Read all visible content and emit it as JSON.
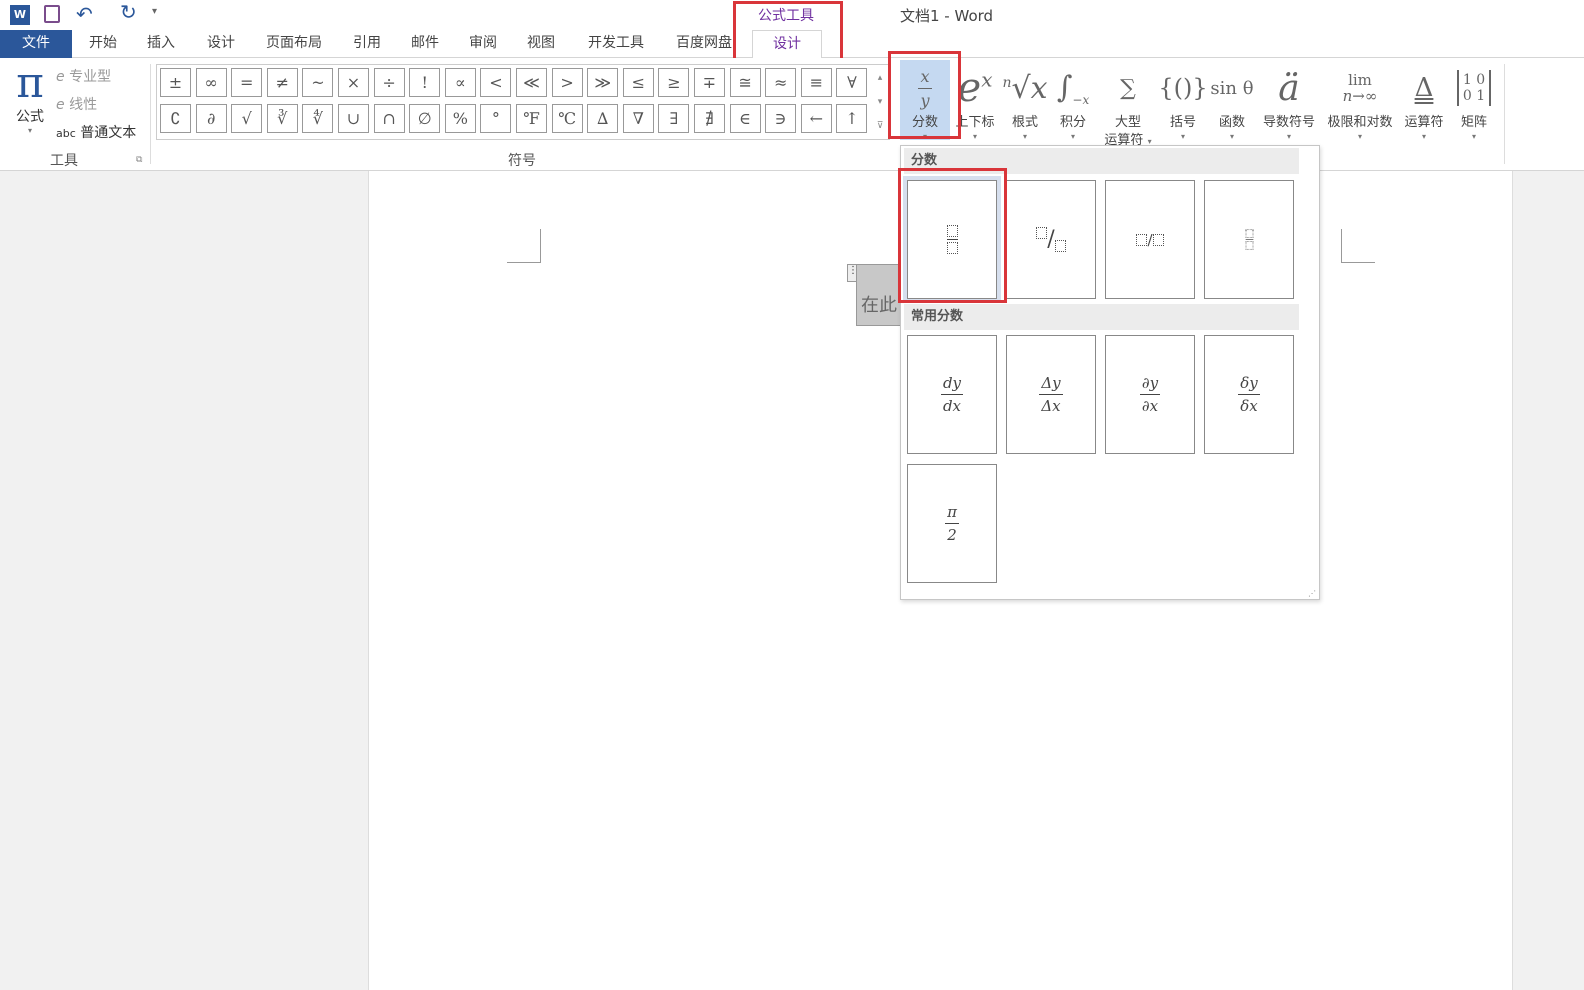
{
  "window": {
    "title": "文档1 - Word"
  },
  "quick_access": {
    "icons": [
      "word-logo-icon",
      "save-icon",
      "undo-icon",
      "redo-icon",
      "customize-icon"
    ]
  },
  "contextual": {
    "group": "公式工具",
    "tab": "设计"
  },
  "tabs": [
    "文件",
    "开始",
    "插入",
    "设计",
    "页面布局",
    "引用",
    "邮件",
    "审阅",
    "视图",
    "开发工具",
    "百度网盘"
  ],
  "tools_group": {
    "label": "工具",
    "equation": "公式",
    "professional": "专业型",
    "linear": "线性",
    "normal_text": "普通文本",
    "abc": "abc"
  },
  "symbols_group": {
    "label": "符号",
    "row1": [
      "±",
      "∞",
      "=",
      "≠",
      "~",
      "×",
      "÷",
      "!",
      "∝",
      "<",
      "≪",
      ">",
      "≫",
      "≤",
      "≥",
      "∓",
      "≅",
      "≈",
      "≡",
      "∀"
    ],
    "row2": [
      "∁",
      "∂",
      "√",
      "∛",
      "∜",
      "∪",
      "∩",
      "∅",
      "%",
      "°",
      "℉",
      "℃",
      "∆",
      "∇",
      "∃",
      "∄",
      "∈",
      "∋",
      "←",
      "↑"
    ]
  },
  "structures": [
    {
      "label": "分数",
      "icon": "x/y"
    },
    {
      "label": "上下标",
      "icon": "eˣ"
    },
    {
      "label": "根式",
      "icon": "ⁿ√x"
    },
    {
      "label": "积分",
      "icon": "∫"
    },
    {
      "label": "大型\n运算符",
      "l1": "大型",
      "l2": "运算符",
      "icon": "∑"
    },
    {
      "label": "括号",
      "icon": "{()}"
    },
    {
      "label": "函数",
      "icon": "sin θ"
    },
    {
      "label": "导数符号",
      "icon": "ä"
    },
    {
      "label": "极限和对数",
      "icon": "lim n→∞"
    },
    {
      "label": "运算符",
      "icon": "Δ"
    },
    {
      "label": "矩阵",
      "icon": "[1 0; 0 1]"
    }
  ],
  "document": {
    "placeholder": "在此"
  },
  "fraction_dropdown": {
    "section1": "分数",
    "section2": "常用分数",
    "common": [
      {
        "num": "dy",
        "den": "dx"
      },
      {
        "num": "Δy",
        "den": "Δx"
      },
      {
        "num": "∂y",
        "den": "∂x"
      },
      {
        "num": "δy",
        "den": "δx"
      },
      {
        "num": "π",
        "den": "2"
      }
    ]
  },
  "colors": {
    "file_tab": "#2b579a",
    "contextual": "#7030a0",
    "highlight": "#c5d9f1",
    "annotation": "#d9353a"
  }
}
